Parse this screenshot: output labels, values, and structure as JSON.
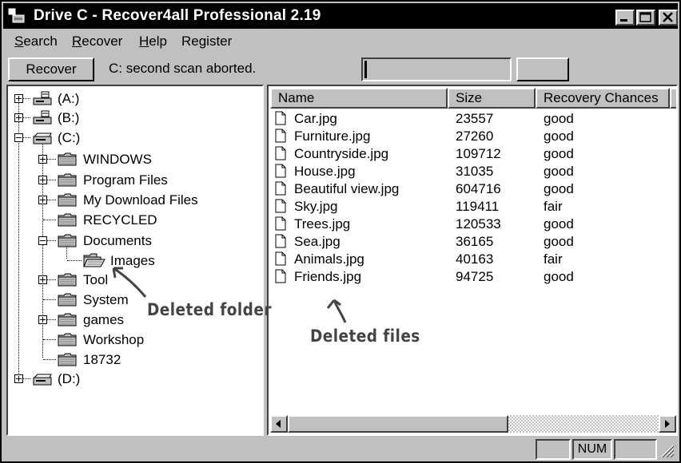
{
  "window": {
    "title": "Drive C  - Recover4all Professional 2.19"
  },
  "menu": [
    {
      "first": "S",
      "rest": "earch"
    },
    {
      "first": "R",
      "rest": "ecover"
    },
    {
      "first": "H",
      "rest": "elp"
    },
    {
      "first": "",
      "rest": "Register"
    }
  ],
  "toolbar": {
    "recover_label": "Recover",
    "status": "C: second scan aborted.",
    "progress_fraction": 0.01
  },
  "tree": {
    "drive_a": "(A:)",
    "drive_b": "(B:)",
    "drive_c": "(C:)",
    "drive_d": "(D:)",
    "folders": [
      "WINDOWS",
      "Program Files",
      "My Download Files",
      "RECYCLED",
      "Documents",
      "Images",
      "Tool",
      "System",
      "games",
      "Workshop",
      "18732"
    ]
  },
  "list": {
    "columns": [
      "Name",
      "Size",
      "Recovery Chances"
    ],
    "rows": [
      [
        "Car.jpg",
        "23557",
        "good"
      ],
      [
        "Furniture.jpg",
        "27260",
        "good"
      ],
      [
        "Countryside.jpg",
        "109712",
        "good"
      ],
      [
        "House.jpg",
        "31035",
        "good"
      ],
      [
        "Beautiful view.jpg",
        "604716",
        "good"
      ],
      [
        "Sky.jpg",
        "119411",
        "fair"
      ],
      [
        "Trees.jpg",
        "120533",
        "good"
      ],
      [
        "Sea.jpg",
        "36165",
        "good"
      ],
      [
        "Animals.jpg",
        "40163",
        "fair"
      ],
      [
        "Friends.jpg",
        "94725",
        "good"
      ]
    ]
  },
  "statusbar": {
    "num": "NUM"
  },
  "annotations": {
    "deleted_folder": "Deleted folder",
    "deleted_files": "Deleted files"
  },
  "icons": {
    "app": "drive-icon",
    "minimize": "minimize-icon",
    "maximize": "maximize-icon",
    "close": "close-icon",
    "folder": "folder-icon",
    "file": "file-icon",
    "drive": "drive-icon"
  }
}
